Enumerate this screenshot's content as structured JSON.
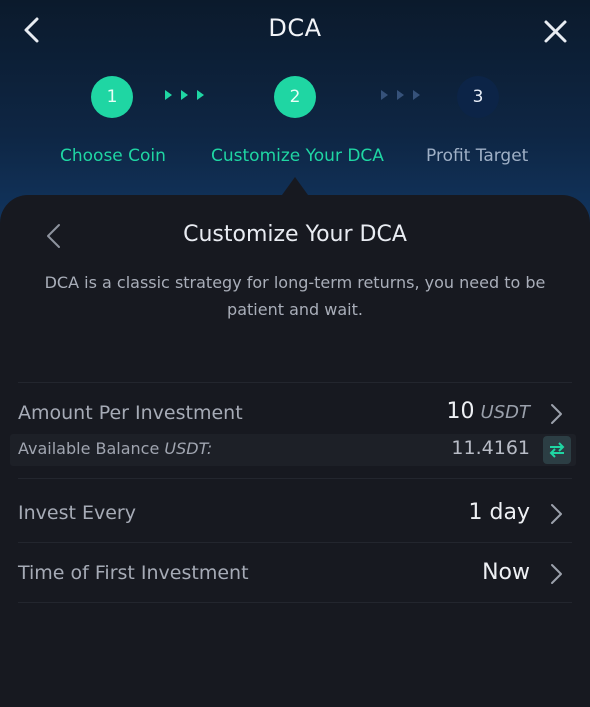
{
  "header": {
    "title": "DCA"
  },
  "steps": [
    {
      "number": "1",
      "label": "Choose Coin",
      "state": "done"
    },
    {
      "number": "2",
      "label": "Customize Your DCA",
      "state": "active"
    },
    {
      "number": "3",
      "label": "Profit Target",
      "state": "pending"
    }
  ],
  "card": {
    "title": "Customize Your DCA",
    "description": "DCA is a classic strategy for long-term returns, you need to be patient and wait."
  },
  "form": {
    "amount": {
      "label": "Amount Per Investment",
      "value": "10",
      "unit": "USDT"
    },
    "balance": {
      "label": "Available Balance",
      "unit": "USDT:",
      "value": "11.4161"
    },
    "frequency": {
      "label": "Invest Every",
      "value": "1 day"
    },
    "first_time": {
      "label": "Time of First Investment",
      "value": "Now"
    }
  },
  "colors": {
    "accent": "#1fd6a3",
    "inactive_step": "#0c2447",
    "card_bg": "#171920",
    "header_gradient_top": "#0b1a2c",
    "header_gradient_bottom": "#154173"
  },
  "icons": {
    "back": "chevron-left-icon",
    "close": "close-icon",
    "row_arrow": "chevron-right-icon",
    "swap": "swap-arrows-icon"
  }
}
